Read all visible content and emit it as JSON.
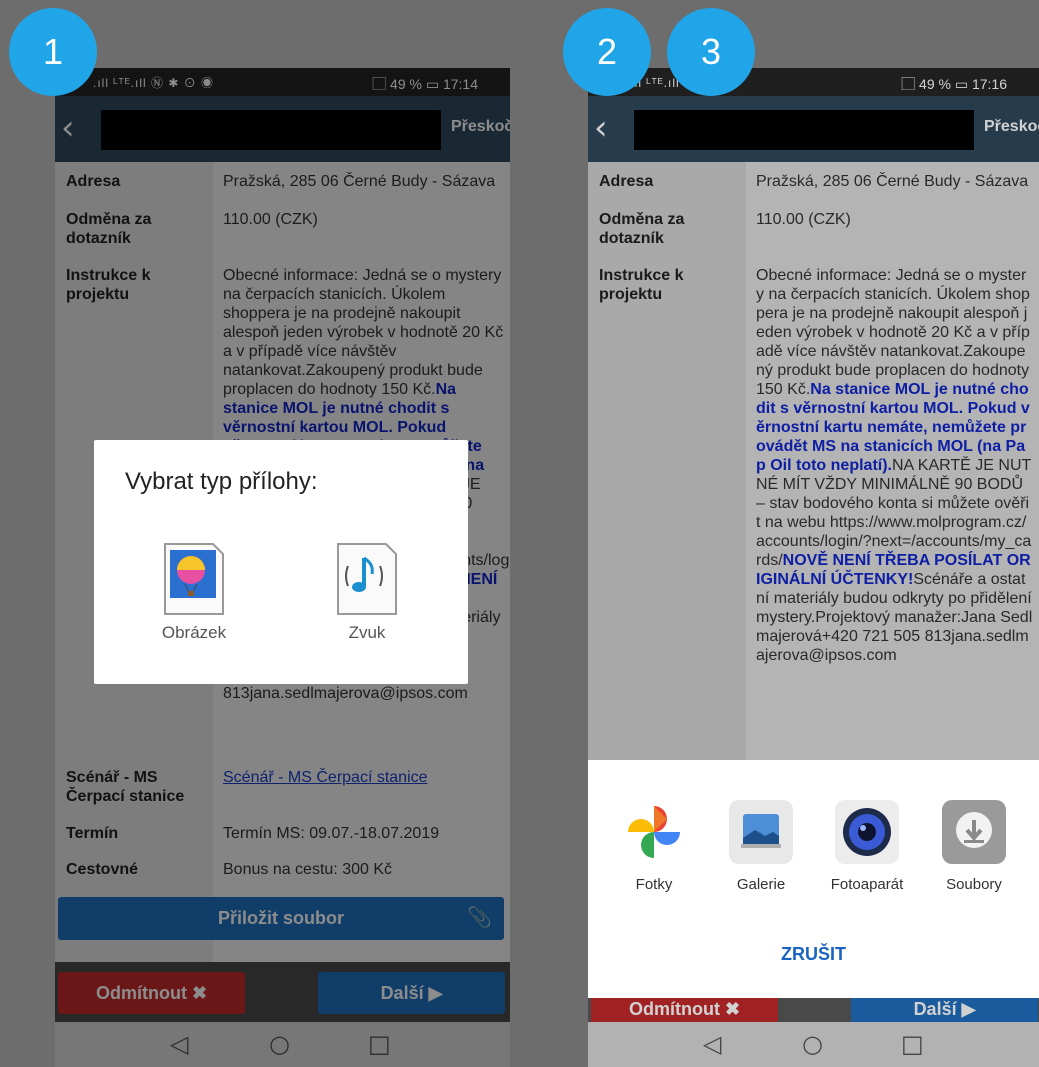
{
  "badges": [
    "1",
    "2",
    "3"
  ],
  "phone1": {
    "status_left": ".ıll ᴸᵀᴱ.ıll Ⓝ ✱ ⊙ ◉",
    "status_right": "⃞ 49 % ▭ 17:14"
  },
  "phone2": {
    "status_left": ".ıll ᴸᵀᴱ.ıll Ⓝ",
    "status_right": "⃞ 49 % ▭ 17:16"
  },
  "appbar": {
    "back_glyph": "‹",
    "skip_label": "Přeskoč"
  },
  "rows": {
    "address": {
      "label": "Adresa",
      "value": "Pražská, 285 06 Černé Budy - Sázava"
    },
    "reward": {
      "label": "Odměna za dotazník",
      "value": "110.00 (CZK)"
    },
    "instructions": {
      "label": "Instrukce k projektu",
      "text1": "Obecné informace: Jedná se o mystery na čerpacích stanicích. Úkolem shoppera je na prodejně nakoupit alespoň jeden výrobek v hodnotě 20 Kč a v případě více návštěv natankovat.Zakoupený produkt bude proplacen do hodnoty 150 Kč.",
      "blue1": "Na stanice MOL je nutné chodit s věrnostní kartou MOL. Pokud věrnostní kartu nemáte, nemůžete provádět MS na stanicích MOL (na Pap Oil toto neplatí).",
      "text2": "NA KARTĚ JE NUTNÉ MÍT VŽDY MINIMÁLNĚ 90 BODŮ – stav bodového konta si můžete ověřit na webu https://www.molprogram.cz/accounts/login/?next=/accounts/my_cards/",
      "blue2": "NOVĚ NENÍ TŘEBA POSÍLAT ORIGINÁLNÍ ÚČTENKY!",
      "text3": "Scénáře a ostatní materiály budou odkryty po přidělení mystery.Projektový manažer:Jana Sedlmajerová+420 721 505 813jana.sedlmajerova@ipsos.com"
    },
    "scenario": {
      "label": "Scénář - MS Čerpací stanice",
      "value": "Scénář - MS Čerpací stanice"
    },
    "term": {
      "label": "Termín",
      "value": "Termín MS: 09.07.-18.07.2019"
    },
    "travel": {
      "label": "Cestovné",
      "value": "Bonus na cestu: 300 Kč"
    }
  },
  "attach_label": "Přiložit soubor",
  "reject_label": "Odmítnout ✖",
  "next_label": "Další ▶",
  "nav": {
    "back": "◁",
    "home": "○",
    "recent": "□"
  },
  "dialog": {
    "title": "Vybrat typ přílohy:",
    "options": [
      {
        "label": "Obrázek",
        "icon": "image-icon"
      },
      {
        "label": "Zvuk",
        "icon": "music-note-icon"
      }
    ]
  },
  "sheet": {
    "apps": [
      {
        "label": "Fotky",
        "icon": "google-photos-icon"
      },
      {
        "label": "Galerie",
        "icon": "gallery-icon"
      },
      {
        "label": "Fotoaparát",
        "icon": "camera-icon"
      },
      {
        "label": "Soubory",
        "icon": "download-icon"
      }
    ],
    "cancel": "ZRUŠIT"
  }
}
